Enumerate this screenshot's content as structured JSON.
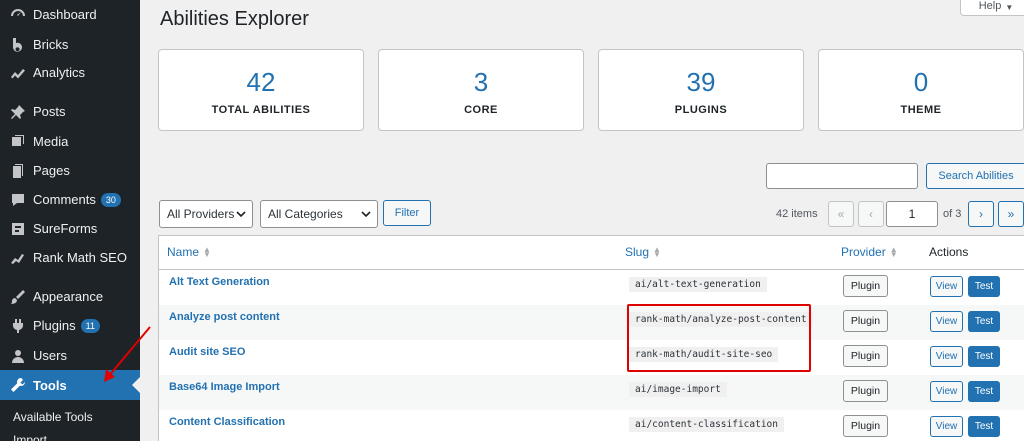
{
  "sidebar": {
    "items": [
      {
        "label": "Dashboard",
        "icon": "dashboard-icon"
      },
      {
        "label": "Bricks",
        "icon": "bricks-icon"
      },
      {
        "label": "Analytics",
        "icon": "analytics-icon"
      },
      {
        "label": "Posts",
        "icon": "pin-icon"
      },
      {
        "label": "Media",
        "icon": "media-icon"
      },
      {
        "label": "Pages",
        "icon": "pages-icon"
      },
      {
        "label": "Comments",
        "icon": "comments-icon",
        "badge": "30"
      },
      {
        "label": "SureForms",
        "icon": "sureforms-icon"
      },
      {
        "label": "Rank Math SEO",
        "icon": "rank-math-icon"
      },
      {
        "label": "Appearance",
        "icon": "brush-icon"
      },
      {
        "label": "Plugins",
        "icon": "plugins-icon",
        "badge": "11"
      },
      {
        "label": "Users",
        "icon": "users-icon"
      },
      {
        "label": "Tools",
        "icon": "wrench-icon",
        "active": true
      }
    ],
    "submenu": [
      "Available Tools",
      "Import"
    ]
  },
  "header": {
    "title": "Abilities Explorer",
    "help": "Help"
  },
  "stats": [
    {
      "value": "42",
      "label": "TOTAL ABILITIES"
    },
    {
      "value": "3",
      "label": "CORE"
    },
    {
      "value": "39",
      "label": "PLUGINS"
    },
    {
      "value": "0",
      "label": "THEME"
    }
  ],
  "search": {
    "value": "",
    "button": "Search Abilities"
  },
  "filters": {
    "providers": "All Providers",
    "categories": "All Categories",
    "button": "Filter"
  },
  "pagination": {
    "items": "42 items",
    "first": "«",
    "prev": "‹",
    "current": "1",
    "of": "of 3",
    "next": "›",
    "last": "»"
  },
  "table": {
    "headers": {
      "name": "Name",
      "slug": "Slug",
      "provider": "Provider",
      "actions": "Actions"
    },
    "rows": [
      {
        "name": "Alt Text Generation",
        "slug": "ai/alt-text-generation",
        "provider": "Plugin",
        "view": "View",
        "test": "Test"
      },
      {
        "name": "Analyze post content",
        "slug": "rank-math/analyze-post-content",
        "provider": "Plugin",
        "view": "View",
        "test": "Test"
      },
      {
        "name": "Audit site SEO",
        "slug": "rank-math/audit-site-seo",
        "provider": "Plugin",
        "view": "View",
        "test": "Test"
      },
      {
        "name": "Base64 Image Import",
        "slug": "ai/image-import",
        "provider": "Plugin",
        "view": "View",
        "test": "Test"
      },
      {
        "name": "Content Classification",
        "slug": "ai/content-classification",
        "provider": "Plugin",
        "view": "View",
        "test": "Test"
      }
    ]
  },
  "colors": {
    "accent": "#2271b1",
    "sidebar": "#1d2327",
    "highlight": "#e00000"
  }
}
